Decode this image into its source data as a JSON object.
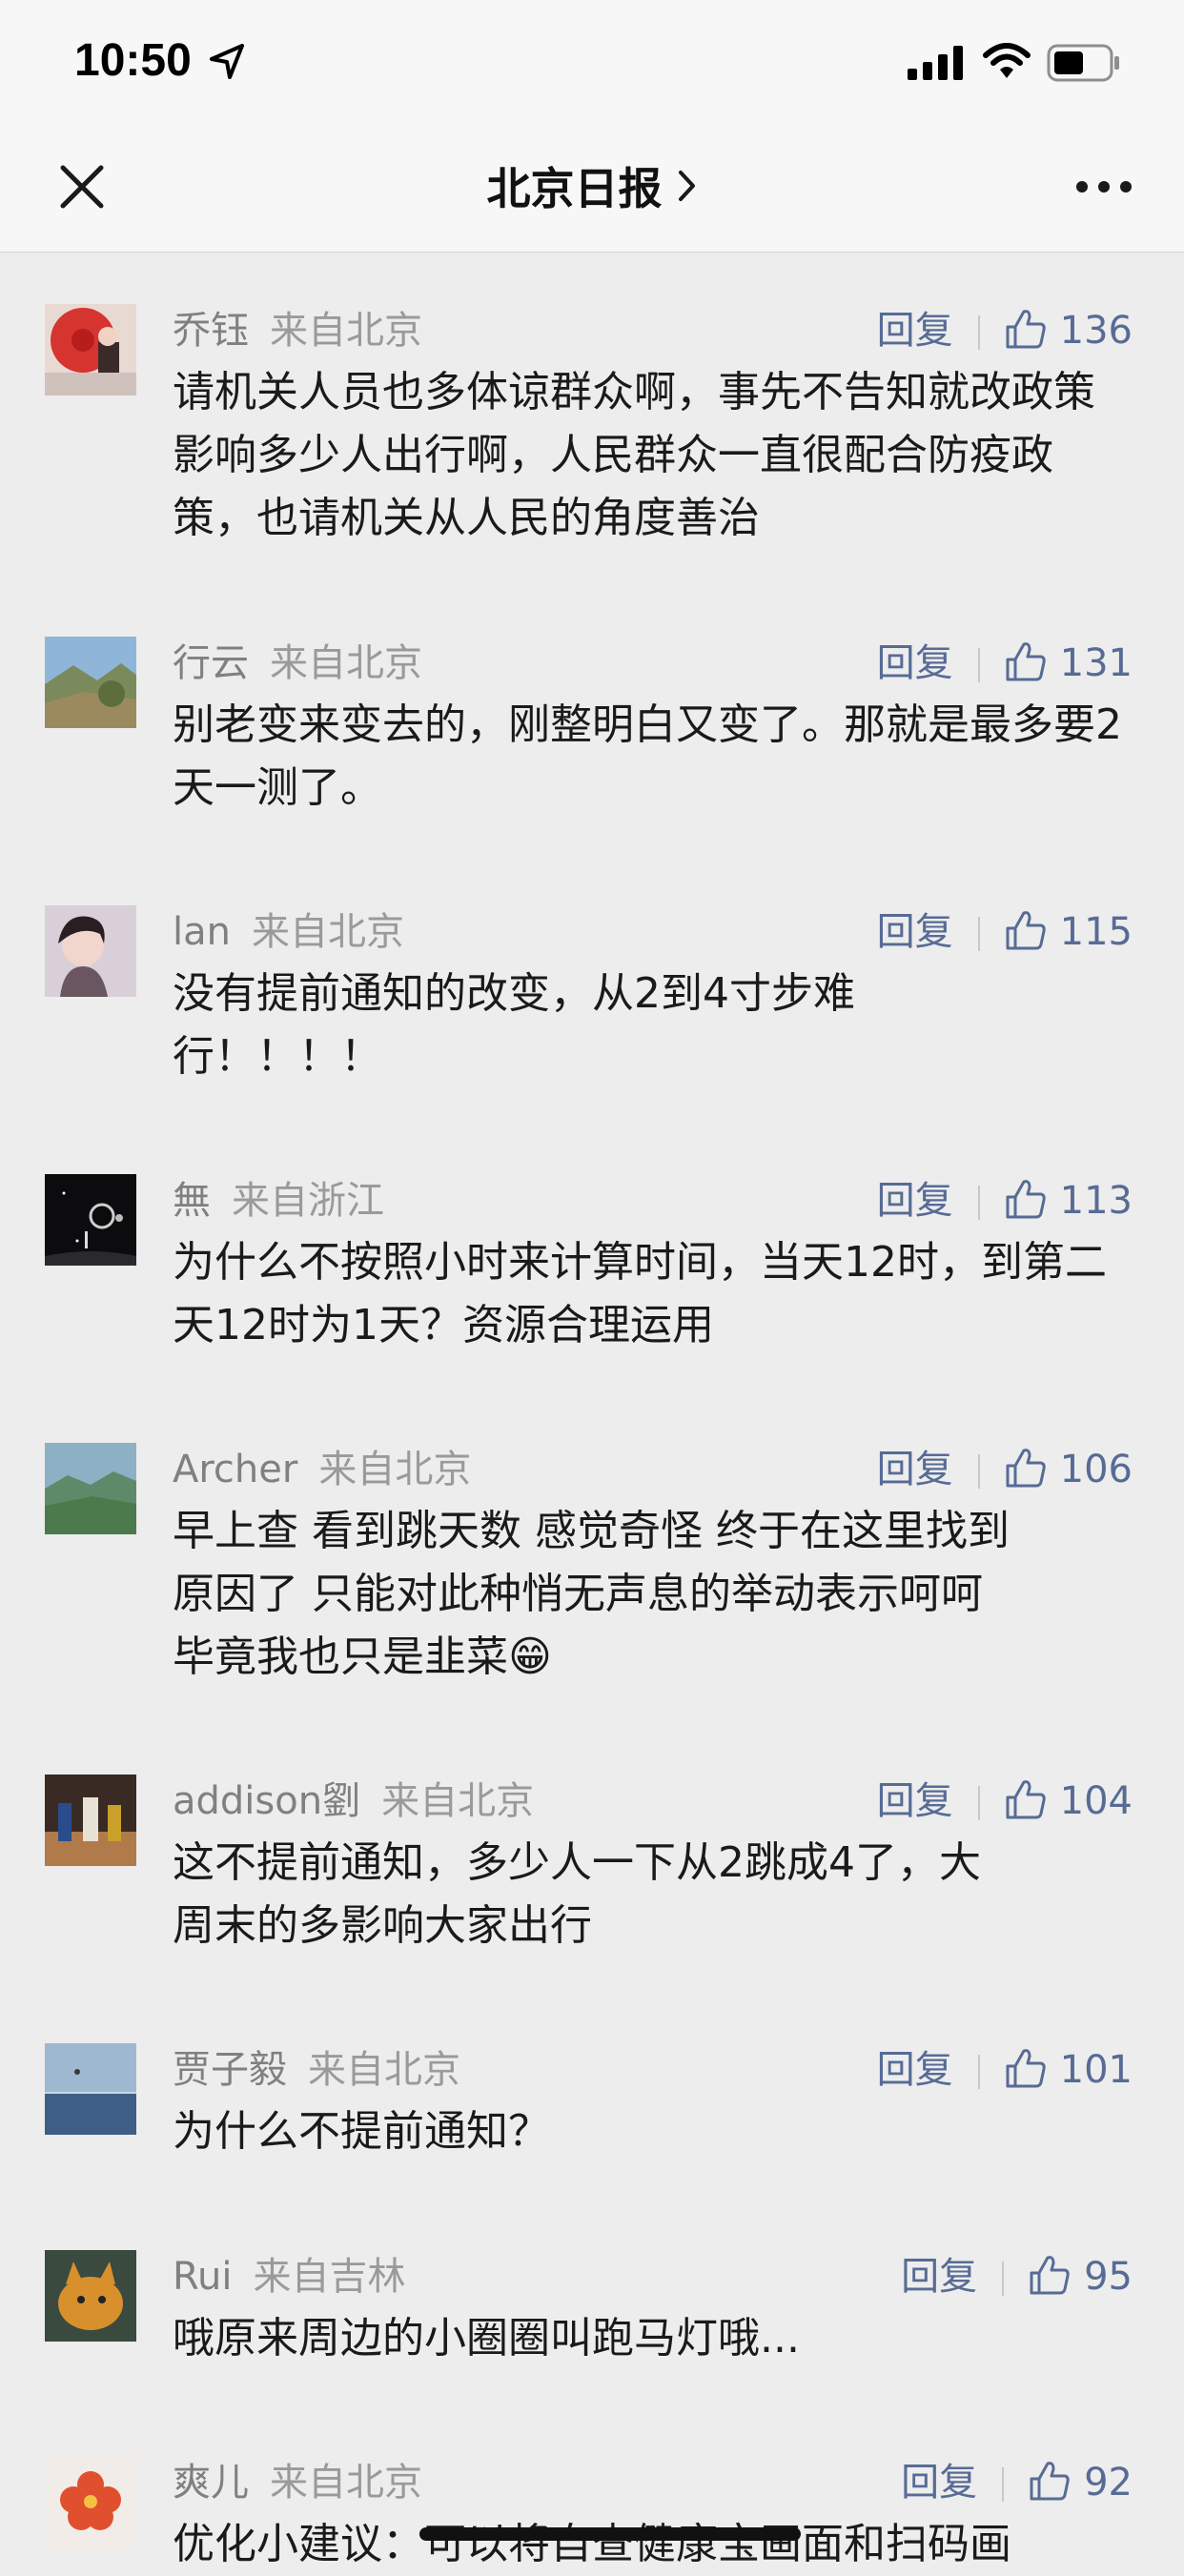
{
  "status_bar": {
    "time": "10:50"
  },
  "nav": {
    "title": "北京日报"
  },
  "reply_label": "回复",
  "comments": [
    {
      "user": "乔钰",
      "location": "来自北京",
      "likes": "136",
      "content": "请机关人员也多体谅群众啊，事先不告知就改政策影响多少人出行啊，人民群众一直很配合防疫政策，也请机关从人民的角度善治"
    },
    {
      "user": "行云",
      "location": "来自北京",
      "likes": "131",
      "content": "别老变来变去的，刚整明白又变了。那就是最多要2天一测了。"
    },
    {
      "user": "lan",
      "location": "来自北京",
      "likes": "115",
      "content": "没有提前通知的改变，从2到4寸步难\n行！！！！"
    },
    {
      "user": "無",
      "location": "来自浙江",
      "likes": "113",
      "content": "为什么不按照小时来计算时间，当天12时，到第二天12时为1天？资源合理运用"
    },
    {
      "user": "Archer",
      "location": "来自北京",
      "likes": "106",
      "content": "早上查 看到跳天数 感觉奇怪 终于在这里找到\n原因了 只能对此种悄无声息的举动表示呵呵\n毕竟我也只是韭菜😁"
    },
    {
      "user": "addison劉",
      "location": "来自北京",
      "likes": "104",
      "content": "这不提前通知，多少人一下从2跳成4了，大\n周末的多影响大家出行"
    },
    {
      "user": "贾子毅",
      "location": "来自北京",
      "likes": "101",
      "content": "为什么不提前通知？"
    },
    {
      "user": "Rui",
      "location": "来自吉林",
      "likes": "95",
      "content": "哦原来周边的小圈圈叫跑马灯哦..."
    },
    {
      "user": "爽儿",
      "location": "来自北京",
      "likes": "92",
      "content": "优化小建议：可以将自查健康宝画面和扫码画"
    }
  ]
}
